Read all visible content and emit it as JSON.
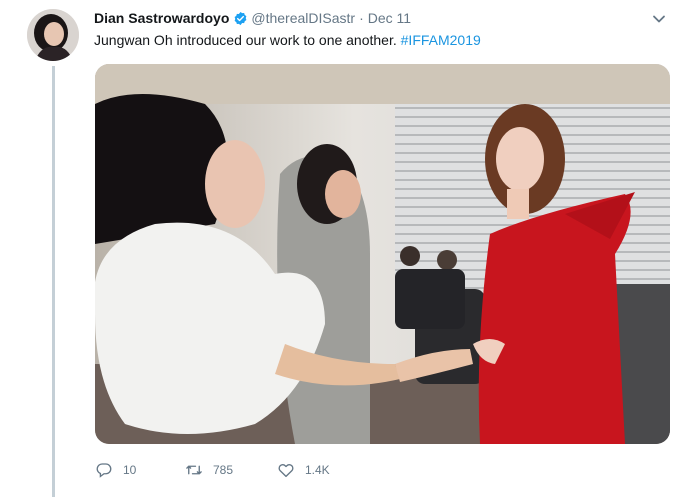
{
  "tweet": {
    "author_name": "Dian Sastrowardoyo",
    "handle": "@therealDISastr",
    "separator": "·",
    "date": "Dec 11",
    "text": "Jungwan Oh introduced our work to one another. ",
    "hashtag": "#IFFAM2019",
    "verified": true
  },
  "actions": {
    "replies": "10",
    "retweets": "785",
    "likes": "1.4K"
  },
  "icons": {
    "verified": "verified-badge-icon",
    "menu": "chevron-down-icon",
    "reply": "reply-icon",
    "retweet": "retweet-icon",
    "like": "heart-icon"
  },
  "colors": {
    "link": "#1b95e0",
    "secondary_text": "#657786",
    "verified_blue": "#1da1f2",
    "thread_line": "#c4cfd6",
    "dress_red": "#c8151e"
  }
}
